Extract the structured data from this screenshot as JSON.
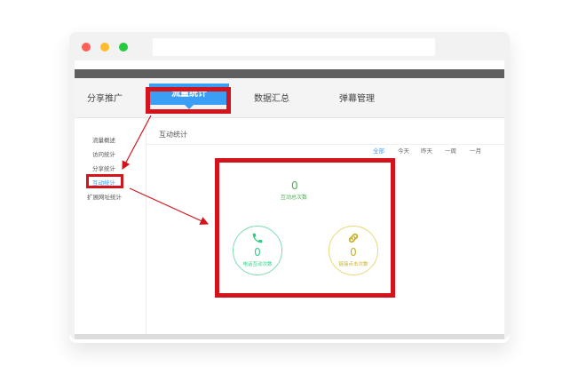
{
  "window": {
    "controls": [
      "close",
      "minimize",
      "zoom"
    ],
    "url": ""
  },
  "top_nav": {
    "items": [
      {
        "label": "分享推广",
        "active": false
      },
      {
        "label": "流量统计",
        "active": true
      },
      {
        "label": "数据汇总",
        "active": false
      },
      {
        "label": "弹幕管理",
        "active": false
      }
    ]
  },
  "sidebar": {
    "items": [
      {
        "label": "流量概述",
        "active": false
      },
      {
        "label": "访问统计",
        "active": false
      },
      {
        "label": "分享统计",
        "active": false
      },
      {
        "label": "互动统计",
        "active": true
      },
      {
        "label": "扩展网址统计",
        "active": false
      }
    ]
  },
  "main": {
    "title": "互动统计",
    "filters": [
      "全部",
      "今天",
      "昨天",
      "一周",
      "一月"
    ],
    "active_filter": "全部",
    "total": {
      "value": "0",
      "label": "互动总次数"
    },
    "phone_stat": {
      "value": "0",
      "label": "电话互动次数",
      "icon": "phone-icon",
      "color": "#2ecf84"
    },
    "link_stat": {
      "value": "0",
      "label": "链接点击次数",
      "icon": "link-icon",
      "color": "#c6b02b"
    }
  },
  "colors": {
    "accent": "#3a9ff4",
    "highlight": "#d4141c",
    "total_green": "#4caf50"
  }
}
